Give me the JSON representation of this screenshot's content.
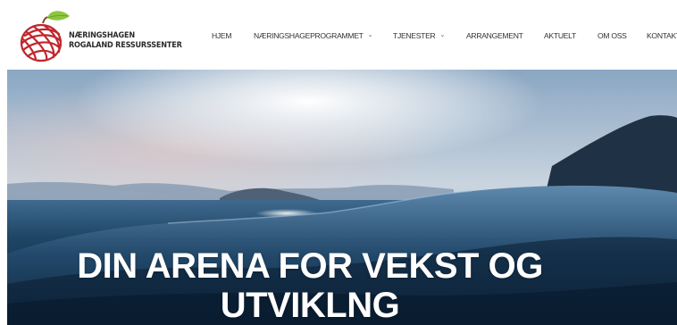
{
  "logo": {
    "line1": "NÆRINGSHAGEN",
    "line2": "ROGALAND RESSURSSENTER",
    "icon": "apple-logo-icon"
  },
  "nav": {
    "items": [
      {
        "label": "HJEM",
        "dropdown": false
      },
      {
        "label": "NÆRINGSHAGEPROGRAMMET",
        "dropdown": true
      },
      {
        "label": "TJENESTER",
        "dropdown": true
      },
      {
        "label": "ARRANGEMENT",
        "dropdown": false
      },
      {
        "label": "AKTUELT",
        "dropdown": false
      },
      {
        "label": "OM OSS",
        "dropdown": false
      },
      {
        "label": "KONTAKT",
        "dropdown": false
      }
    ],
    "chevron_icon": "chevron-down-icon"
  },
  "hero": {
    "title_line1": "DIN ARENA FOR VEKST OG",
    "title_line2": "UTVIKLNG"
  },
  "colors": {
    "logo_red": "#c0272d",
    "logo_green": "#8cc63f",
    "sea_dark": "#0f2a45",
    "sky_light": "#d8e2ec"
  }
}
